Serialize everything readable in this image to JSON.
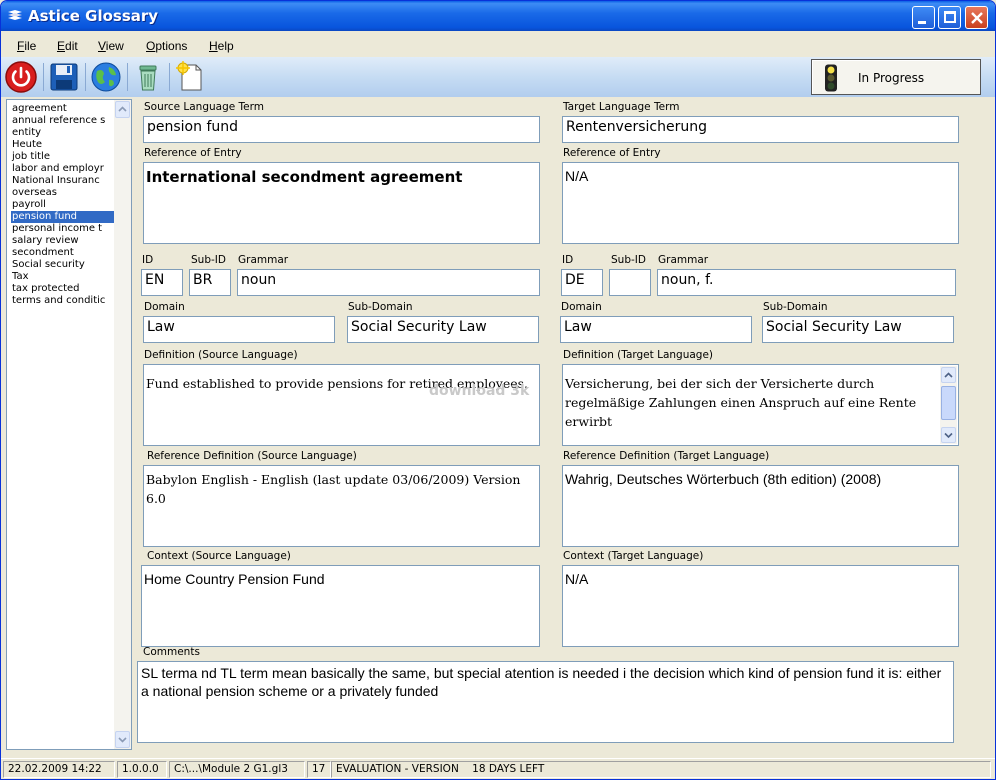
{
  "window": {
    "title": "Astice Glossary"
  },
  "menu": [
    "File",
    "Edit",
    "View",
    "Options",
    "Help"
  ],
  "toolbar": {
    "icons": [
      "power-icon",
      "save-icon",
      "globe-icon",
      "trash-icon",
      "new-document-icon"
    ],
    "status_label": "In Progress"
  },
  "terms": [
    "agreement",
    "annual reference s",
    "entity",
    "Heute",
    "job title",
    "labor and employr",
    "National Insuranc",
    "overseas",
    "payroll",
    "pension fund",
    "personal income t",
    "salary review",
    "secondment",
    "Social security",
    "Tax",
    "tax protected",
    "terms and conditic"
  ],
  "selected_term_index": 9,
  "source": {
    "term_label": "Source Language Term",
    "term": "pension fund",
    "reference_label": "Reference of Entry",
    "reference": "International secondment agreement",
    "id_label": "ID",
    "id": "EN",
    "subid_label": "Sub-ID",
    "subid": "BR",
    "grammar_label": "Grammar",
    "grammar": "noun",
    "domain_label": "Domain",
    "domain": "Law",
    "subdomain_label": "Sub-Domain",
    "subdomain": "Social Security Law",
    "definition_label": "Definition (Source Language)",
    "definition": "Fund established to provide pensions for retired employees.",
    "ref_def_label": "Reference Definition (Source Language)",
    "ref_def": "Babylon English - English (last update 03/06/2009) Version 6.0",
    "context_label": "Context (Source Language)",
    "context": "Home Country Pension Fund"
  },
  "target": {
    "term_label": "Target Language Term",
    "term": "Rentenversicherung",
    "reference_label": "Reference of Entry",
    "reference": "N/A",
    "id_label": "ID",
    "id": "DE",
    "subid_label": "Sub-ID",
    "subid": "",
    "grammar_label": "Grammar",
    "grammar": "noun, f.",
    "domain_label": "Domain",
    "domain": "Law",
    "subdomain_label": "Sub-Domain",
    "subdomain": "Social Security Law",
    "definition_label": "Definition (Target Language)",
    "definition": "Versicherung, bei der sich der Versicherte durch regelmäßige Zahlungen einen Anspruch auf eine Rente erwirbt",
    "ref_def_label": "Reference Definition (Target Language)",
    "ref_def": "Wahrig, Deutsches Wörterbuch (8th edition) (2008)",
    "context_label": "Context (Target Language)",
    "context": "N/A"
  },
  "comments": {
    "label": "Comments",
    "text": "SL terma nd TL term mean basically the same, but special atention is needed i the decision which kind of pension fund it is: either a national pension scheme or a privately funded"
  },
  "watermark": "download 3k",
  "statusbar": {
    "datetime": "22.02.2009 14:22",
    "version": "1.0.0.0",
    "file": "C:\\...\\Module 2 G1.gl3",
    "count": "17",
    "message": "EVALUATION - VERSION    18 DAYS LEFT"
  }
}
